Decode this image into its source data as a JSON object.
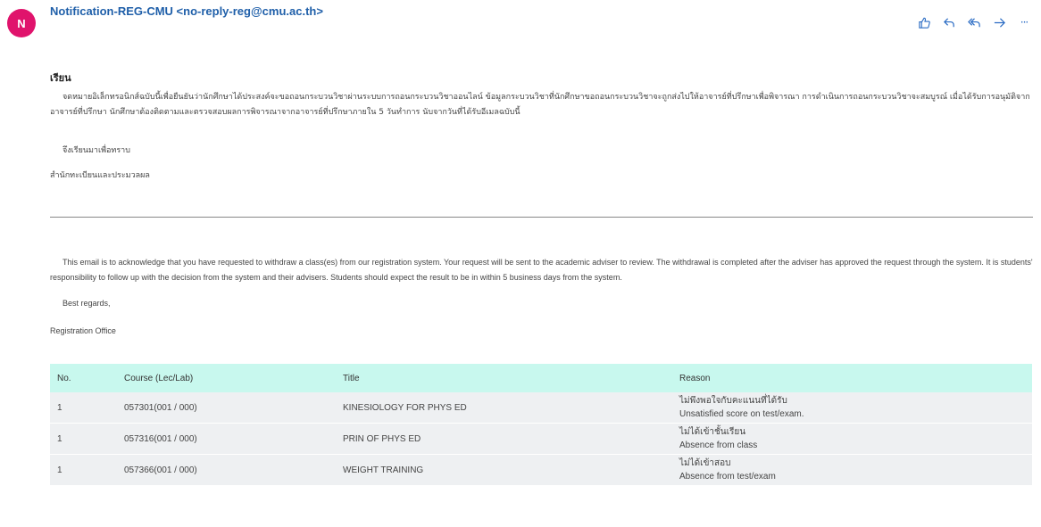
{
  "colors": {
    "avatar_bg": "#e0136c",
    "sender": "#1f5fa9",
    "toolbar_icon": "#2b6cc4",
    "header_row_bg": "#c8f8ee",
    "row_bg": "#eef0f2"
  },
  "header": {
    "avatar_initial": "N",
    "sender": "Notification-REG-CMU <no-reply-reg@cmu.ac.th>",
    "toolbar": [
      {
        "icon": "thumbs-up-icon"
      },
      {
        "icon": "reply-icon"
      },
      {
        "icon": "reply-all-icon"
      },
      {
        "icon": "forward-icon"
      },
      {
        "icon": "more-icon",
        "glyph": "···"
      }
    ]
  },
  "thai": {
    "greeting": "เรียน ",
    "paragraph": "จดหมายอิเล็กทรอนิกส์ฉบับนี้เพื่อยืนยันว่านักศึกษาได้ประสงค์จะขอถอนกระบวนวิชาผ่านระบบการถอนกระบวนวิชาออนไลน์ ข้อมูลกระบวนวิชาที่นักศึกษาขอถอนกระบวนวิชาจะถูกส่งไปให้อาจารย์ที่ปรึกษาเพื่อพิจารณา การดำเนินการถอนกระบวนวิชาจะสมบูรณ์ เมื่อได้รับการอนุมัติจากอาจารย์ที่ปรึกษา นักศึกษาต้องติดตามและตรวจสอบผลการพิจารณาจากอาจารย์ที่ปรึกษาภายใน 5 วันทำการ นับจากวันที่ได้รับอีเมลฉบับนี้",
    "closing": "จึงเรียนมาเพื่อทราบ",
    "office": "สำนักทะเบียนและประมวลผล"
  },
  "english": {
    "paragraph": "This email is to acknowledge that you have requested to withdraw a class(es) from our registration system. Your request will be sent to the academic adviser to review. The withdrawal is completed after the adviser has approved the request through the system. It is students' responsibility to follow up with the decision from the system and their advisers. Students should expect the result to be in within 5 business days from the system.",
    "closing": "Best regards,",
    "office": "Registration Office"
  },
  "table": {
    "headers": [
      "No.",
      "Course (Lec/Lab)",
      "Title",
      "Reason"
    ],
    "rows": [
      {
        "no": "1",
        "course": "057301(001 / 000)",
        "title": "KINESIOLOGY FOR PHYS ED",
        "reason_th": "ไม่พึงพอใจกับคะแนนที่ได้รับ",
        "reason_en": "Unsatisfied score on test/exam."
      },
      {
        "no": "1",
        "course": "057316(001 / 000)",
        "title": "PRIN OF PHYS ED",
        "reason_th": "ไม่ได้เข้าชั้นเรียน",
        "reason_en": "Absence from class"
      },
      {
        "no": "1",
        "course": "057366(001 / 000)",
        "title": "WEIGHT TRAINING",
        "reason_th": "ไม่ได้เข้าสอบ",
        "reason_en": "Absence from test/exam"
      }
    ]
  }
}
